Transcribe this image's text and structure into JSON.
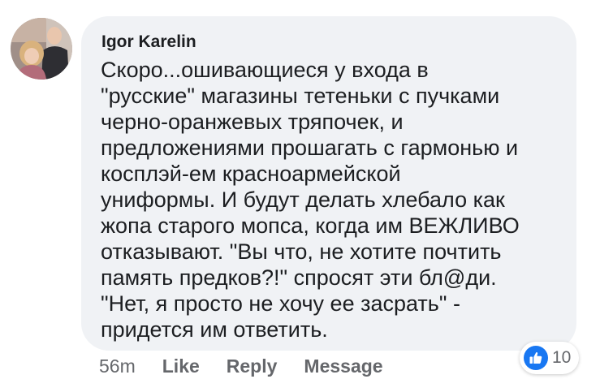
{
  "comment": {
    "author": "Igor Karelin",
    "text_lines": [
      "Скоро...ошивающиеся у входа в",
      "\"русские\" магазины тетеньки с пучками",
      "черно-оранжевых тряпочек, и",
      "предложениями прошагать с гармонью и",
      "косплэй-ем красноармейской",
      "униформы. И будут делать хлебало как",
      "жопа старого мопса, когда им ВЕЖЛИВО",
      "отказывают. \"Вы что, не хотите почтить",
      "память предков?!\" спросят эти бл@ди.",
      "\"Нет, я просто не хочу ее засрать\" -",
      "придется им ответить."
    ]
  },
  "actions": {
    "timestamp": "56m",
    "like_label": "Like",
    "reply_label": "Reply",
    "message_label": "Message"
  },
  "reactions": {
    "icon": "thumbs-up-icon",
    "count": "10"
  },
  "colors": {
    "bubble_bg": "#f0f2f5",
    "text": "#1c1e21",
    "muted": "#65676b",
    "like_blue": "#1877f2"
  }
}
